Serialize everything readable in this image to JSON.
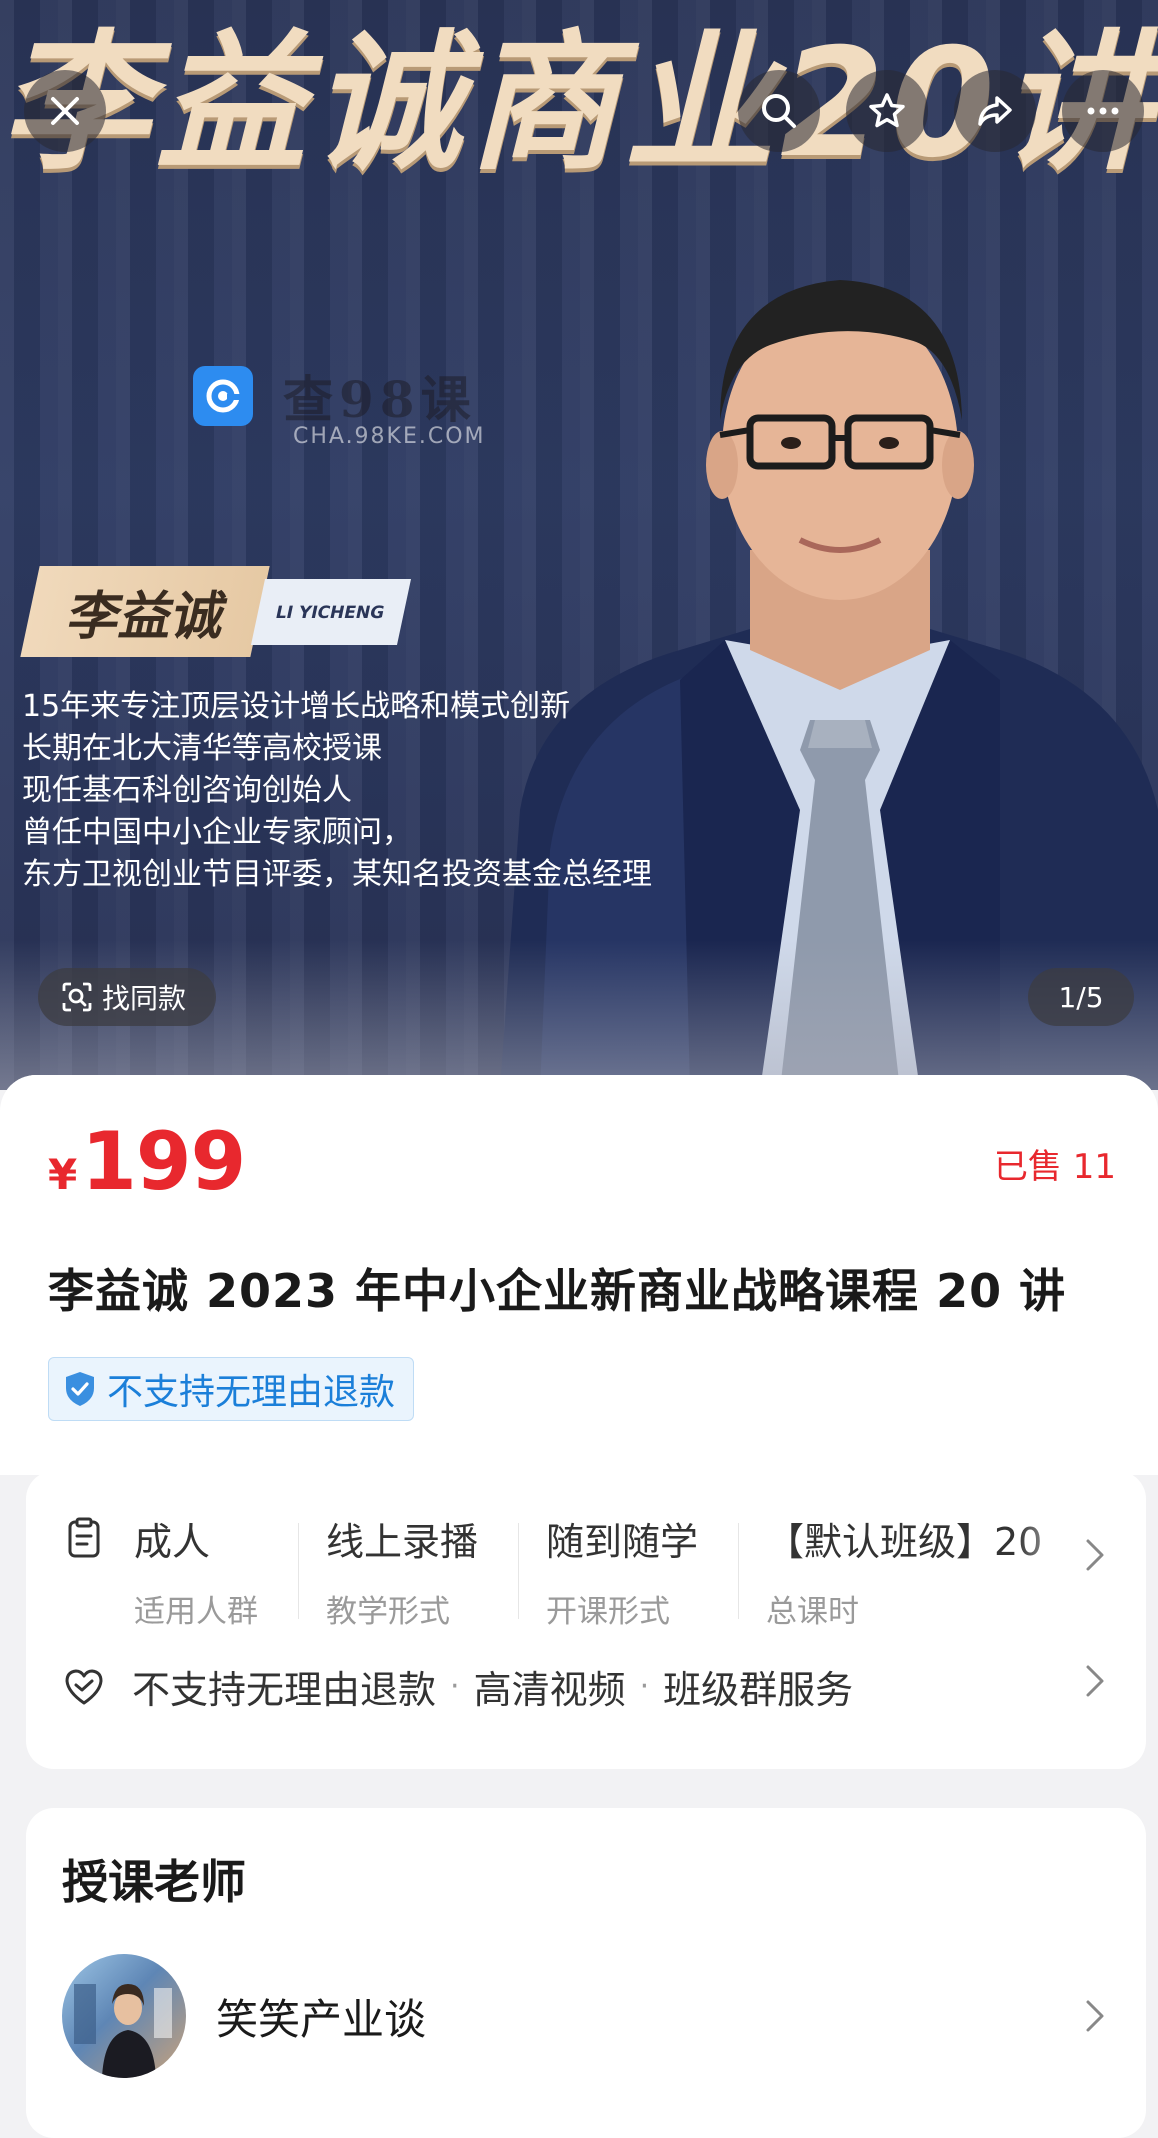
{
  "hero": {
    "banner_title": "李益诚商业20讲",
    "watermark": {
      "main": "查98课",
      "sub": "CHA.98KE.COM"
    },
    "name_tag": {
      "name": "李益诚",
      "pinyin": "LI YICHENG"
    },
    "bio": [
      "15年来专注顶层设计增长战略和模式创新",
      "长期在北大清华等高校授课",
      "现任基石科创咨询创始人",
      "曾任中国中小企业专家顾问，",
      "东方卫视创业节目评委，某知名投资基金总经理"
    ],
    "find_same_label": "找同款",
    "page_indicator": "1/5"
  },
  "top_bar": {
    "icons": [
      "close-icon",
      "search-icon",
      "star-icon",
      "share-icon",
      "more-icon"
    ]
  },
  "product": {
    "price_symbol": "¥",
    "price": "199",
    "sold": "已售 11",
    "title": "李益诚 2023 年中小企业新商业战略课程 20 讲",
    "refund_tag": "不支持无理由退款"
  },
  "info": {
    "columns": [
      {
        "value": "成人",
        "label": "适用人群"
      },
      {
        "value": "线上录播",
        "label": "教学形式"
      },
      {
        "value": "随到随学",
        "label": "开课形式"
      },
      {
        "value": "【默认班级】20",
        "label": "总课时"
      }
    ],
    "services": [
      "不支持无理由退款",
      "高清视频",
      "班级群服务"
    ],
    "service_sep": "·"
  },
  "teacher": {
    "heading": "授课老师",
    "name": "笑笑产业谈"
  },
  "colors": {
    "accent_red": "#e8282e",
    "tag_blue": "#1b7fd9",
    "banner_gold": "#f1dcc0",
    "hero_navy": "#2e3b63"
  }
}
